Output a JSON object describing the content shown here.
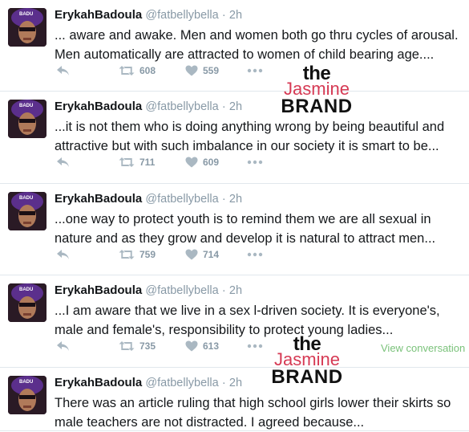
{
  "tweets": [
    {
      "name": "ErykahBadoula",
      "handle": "@fatbellybella",
      "dot": "·",
      "time": "2h",
      "lines": [
        "... aware and awake. Men and women both go thru cycles of arousal.",
        "Men automatically are attracted to women of child bearing age...."
      ],
      "retweets": "608",
      "likes": "559"
    },
    {
      "name": "ErykahBadoula",
      "handle": "@fatbellybella",
      "dot": "·",
      "time": "2h",
      "lines": [
        "...it is not them who is doing anything wrong by being beautiful and",
        "attractive but with such imbalance in our society it is smart to be..."
      ],
      "retweets": "711",
      "likes": "609"
    },
    {
      "name": "ErykahBadoula",
      "handle": "@fatbellybella",
      "dot": "·",
      "time": "2h",
      "lines": [
        "...one way to protect youth is to remind them we are all sexual in",
        "nature and as they grow  and develop it is natural to attract men..."
      ],
      "retweets": "759",
      "likes": "714"
    },
    {
      "name": "ErykahBadoula",
      "handle": "@fatbellybella",
      "dot": "·",
      "time": "2h",
      "lines": [
        "...I am aware that we live in a sex l-driven society. It is everyone's,",
        "male and female's, responsibility to protect young ladies..."
      ],
      "retweets": "735",
      "likes": "613",
      "view_conversation": "View conversation"
    },
    {
      "name": "ErykahBadoula",
      "handle": "@fatbellybella",
      "dot": "·",
      "time": "2h",
      "lines": [
        "There was an article ruling that high school girls lower their skirts so",
        "male teachers are not distracted. I agreed because..."
      ]
    }
  ],
  "watermark": {
    "the": "the",
    "jasmine": "Jasmine",
    "brand": "BRAND"
  },
  "icons": {
    "reply": "reply-icon",
    "retweet": "retweet-icon",
    "like": "heart-icon",
    "more": "more-icon"
  },
  "colors": {
    "muted": "#8899a6",
    "icon": "#aab8c2",
    "link_green": "#7ac27a",
    "watermark_pink": "#d63a54"
  }
}
